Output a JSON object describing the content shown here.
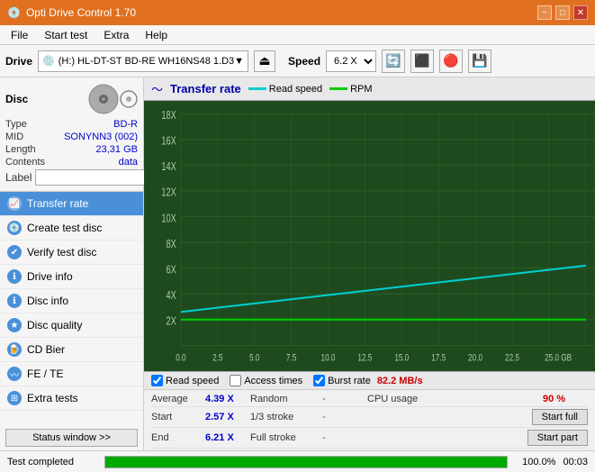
{
  "titleBar": {
    "appName": "Opti Drive Control 1.70",
    "minimize": "−",
    "maximize": "□",
    "close": "✕"
  },
  "menuBar": {
    "items": [
      "File",
      "Start test",
      "Extra",
      "Help"
    ]
  },
  "toolbar": {
    "driveLabel": "Drive",
    "driveValue": "(H:)  HL-DT-ST BD-RE  WH16NS48 1.D3",
    "speedLabel": "Speed",
    "speedValue": "6.2 X"
  },
  "disc": {
    "title": "Disc",
    "typeLabel": "Type",
    "typeValue": "BD-R",
    "midLabel": "MID",
    "midValue": "SONYNN3 (002)",
    "lengthLabel": "Length",
    "lengthValue": "23,31 GB",
    "contentsLabel": "Contents",
    "contentsValue": "data",
    "labelLabel": "Label",
    "labelValue": ""
  },
  "nav": {
    "items": [
      {
        "id": "transfer-rate",
        "label": "Transfer rate",
        "active": true
      },
      {
        "id": "create-test-disc",
        "label": "Create test disc",
        "active": false
      },
      {
        "id": "verify-test-disc",
        "label": "Verify test disc",
        "active": false
      },
      {
        "id": "drive-info",
        "label": "Drive info",
        "active": false
      },
      {
        "id": "disc-info",
        "label": "Disc info",
        "active": false
      },
      {
        "id": "disc-quality",
        "label": "Disc quality",
        "active": false
      },
      {
        "id": "cd-bier",
        "label": "CD Bier",
        "active": false
      },
      {
        "id": "fe-te",
        "label": "FE / TE",
        "active": false
      },
      {
        "id": "extra-tests",
        "label": "Extra tests",
        "active": false
      }
    ],
    "statusWindow": "Status window >>"
  },
  "chart": {
    "title": "Transfer rate",
    "legendReadSpeed": "Read speed",
    "legendRPM": "RPM",
    "yLabels": [
      "18X",
      "16X",
      "14X",
      "12X",
      "10X",
      "8X",
      "6X",
      "4X",
      "2X"
    ],
    "xLabels": [
      "0.0",
      "2.5",
      "5.0",
      "7.5",
      "10.0",
      "12.5",
      "15.0",
      "17.5",
      "20.0",
      "22.5",
      "25.0 GB"
    ]
  },
  "chartControls": {
    "readSpeedLabel": "Read speed",
    "accessTimesLabel": "Access times",
    "burstRateLabel": "Burst rate",
    "burstRateValue": "82.2 MB/s"
  },
  "stats": {
    "average": {
      "label": "Average",
      "value": "4.39 X",
      "label2": "Random",
      "value2": "-",
      "label3": "CPU usage",
      "value3": "90 %"
    },
    "start": {
      "label": "Start",
      "value": "2.57 X",
      "label2": "1/3 stroke",
      "value2": "-",
      "btnLabel": "Start full"
    },
    "end": {
      "label": "End",
      "value": "6.21 X",
      "label2": "Full stroke",
      "value2": "-",
      "btnLabel": "Start part"
    }
  },
  "statusBar": {
    "text": "Test completed",
    "progressPct": 100,
    "progressLabel": "100.0%",
    "time": "00:03"
  }
}
